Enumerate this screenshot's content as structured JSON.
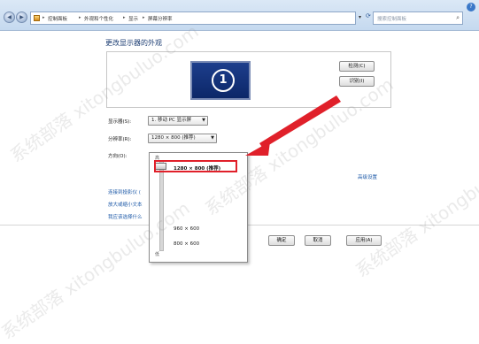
{
  "addressbar": {
    "breadcrumbs": [
      "控制面板",
      "外观和个性化",
      "显示",
      "屏幕分辨率"
    ],
    "search_placeholder": "搜索控制面板"
  },
  "page": {
    "title": "更改显示器的外观"
  },
  "preview": {
    "monitor_number": "1",
    "detect_label": "检测(C)",
    "identify_label": "识别(I)"
  },
  "settings": {
    "display_label": "显示器(S):",
    "display_value": "1. 移动 PC 显示屏",
    "resolution_label": "分辨率(R):",
    "resolution_value": "1280 × 800 (推荐)",
    "orientation_label": "方向(O):",
    "advanced_link": "高级设置"
  },
  "links": [
    "连接到投影仪 (",
    "放大或缩小文本",
    "我应该选择什么"
  ],
  "resolution_popup": {
    "high_label": "高",
    "low_label": "低",
    "selected_option": "1280 × 800 (推荐)",
    "options": [
      "960 × 600",
      "800 × 600"
    ]
  },
  "buttons": {
    "ok": "确定",
    "cancel": "取消",
    "apply": "应用(A)"
  },
  "watermark": "系统部落 xitongbuluo.com",
  "colors": {
    "highlight": "#e0202a",
    "link": "#1e5aa8",
    "monitor": "#1d3e8c"
  }
}
